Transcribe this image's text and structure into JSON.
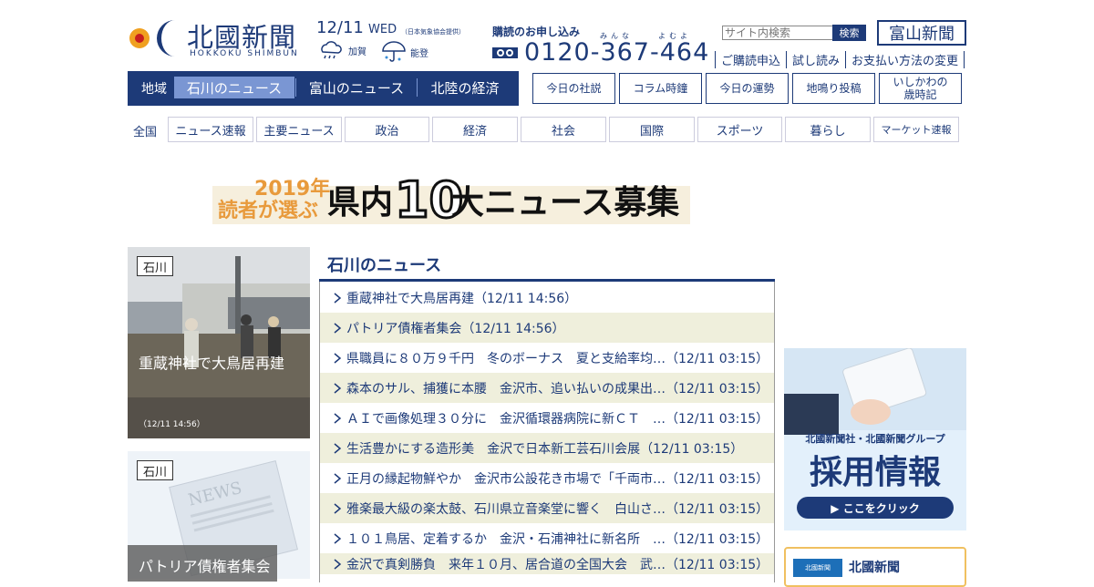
{
  "header": {
    "logo_name": "北國新聞",
    "logo_roman": "HOKKOKU SHIMBUN",
    "date": "12/11",
    "weekday": "WED",
    "date_note": "（日本気象協会提供）",
    "weather": [
      {
        "region": "加賀",
        "icon": "cloud-rain-icon"
      },
      {
        "region": "能登",
        "icon": "umbrella-rain-icon"
      }
    ],
    "subscribe_label": "購読のお申し込み",
    "ruby": [
      "みんな",
      "よむよ"
    ],
    "phone": "0120-367-464",
    "search_placeholder": "サイト内検索",
    "search_button": "検索",
    "toyama_button": "富山新聞",
    "links": [
      "ご購読申込",
      "試し読み",
      "お支払い方法の変更"
    ]
  },
  "region_nav": {
    "label": "地域",
    "tabs": [
      "石川のニュース",
      "富山のニュース",
      "北陸の経済"
    ],
    "active": 0
  },
  "column_buttons": [
    "今日の社説",
    "コラム時鐘",
    "今日の運勢",
    "地鳴り投稿",
    "いしかわの\n歳時記"
  ],
  "category_nav": {
    "label": "全国",
    "items": [
      "ニュース速報",
      "主要ニュース",
      "政治",
      "経済",
      "社会",
      "国際",
      "スポーツ",
      "暮らし",
      "マーケット速報"
    ]
  },
  "banner": {
    "year": "2019年",
    "subtitle": "読者が選ぶ",
    "title_a": "県内",
    "title_num": "10",
    "title_b": "大ニュース募集"
  },
  "photo_cards": [
    {
      "tag": "石川",
      "title": "重蔵神社で大鳥居再建",
      "time": "（12/11 14:56）"
    },
    {
      "tag": "石川",
      "title": "パトリア債権者集会",
      "watermark": "NEWS"
    }
  ],
  "news": {
    "heading": "石川のニュース",
    "items": [
      "重蔵神社で大鳥居再建（12/11 14:56）",
      "パトリア債権者集会（12/11 14:56）",
      "県職員に８０万９千円　冬のボーナス　夏と支給率均…（12/11 03:15）",
      "森本のサル、捕獲に本腰　金沢市、追い払いの成果出…（12/11 03:15）",
      "ＡＩで画像処理３０分に　金沢循環器病院に新ＣＴ　…（12/11 03:15）",
      "生活豊かにする造形美　金沢で日本新工芸石川会展（12/11 03:15）",
      "正月の縁起物鮮やか　金沢市公設花き市場で「千両市…（12/11 03:15）",
      "雅楽最大級の楽太鼓、石川県立音楽堂に響く　白山さ…（12/11 03:15）",
      "１０１鳥居、定着するか　金沢・石浦神社に新名所　…（12/11 03:15）",
      "金沢で真剣勝負　来年１０月、居合道の全国大会　武…（12/11 03:15）"
    ]
  },
  "ads": {
    "recruit_company": "北國新聞社・北國新聞グループ",
    "recruit_title": "採用情報",
    "recruit_button": "▶ ここをクリック",
    "hokkoku_box_label": "北國新聞",
    "hokkoku_box_logo": "北國新聞"
  },
  "colors": {
    "brand": "#1d3a78",
    "accent": "#7a96d3",
    "row_alt": "#efefdc",
    "banner_orange": "#e89a3c"
  }
}
